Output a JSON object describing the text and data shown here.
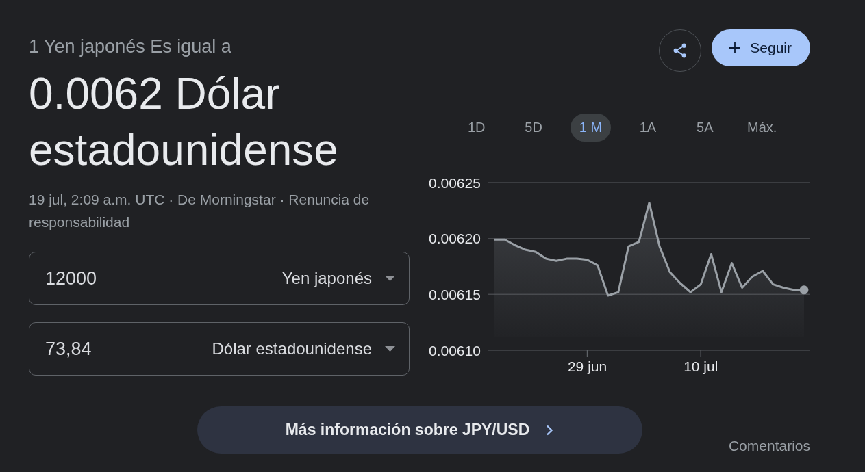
{
  "conversion": {
    "subtitle": "1 Yen japonés Es igual a",
    "result": "0.0062 Dólar estadounidense",
    "source_note": "19 jul, 2:09 a.m. UTC · De Morningstar · Renuncia de responsabilidad"
  },
  "converter": [
    {
      "amount": "12000",
      "currency": "Yen japonés"
    },
    {
      "amount": "73,84",
      "currency": "Dólar estadounidense"
    }
  ],
  "follow_button": {
    "label": "Seguir"
  },
  "range_tabs": [
    {
      "label": "1D",
      "selected": false
    },
    {
      "label": "5D",
      "selected": false
    },
    {
      "label": "1 M",
      "selected": true
    },
    {
      "label": "1A",
      "selected": false
    },
    {
      "label": "5A",
      "selected": false
    },
    {
      "label": "Máx.",
      "selected": false
    }
  ],
  "chart_data": {
    "type": "area",
    "categories": [
      null,
      null,
      null,
      null,
      null,
      null,
      null,
      null,
      null,
      "29 jun",
      null,
      null,
      null,
      null,
      null,
      null,
      null,
      null,
      null,
      null,
      "10 jul",
      null,
      null,
      null,
      null,
      null,
      null,
      null,
      null,
      null,
      null
    ],
    "values": [
      0.006199,
      0.006199,
      0.006194,
      0.00619,
      0.006188,
      0.006182,
      0.00618,
      0.006182,
      0.006182,
      0.006181,
      0.006176,
      0.006149,
      0.006152,
      0.006193,
      0.006197,
      0.006232,
      0.006193,
      0.00617,
      0.00616,
      0.006152,
      0.006159,
      0.006186,
      0.006152,
      0.006178,
      0.006156,
      0.006166,
      0.006171,
      0.006159,
      0.006156,
      0.006154,
      0.006154
    ],
    "ylim": [
      0.0061,
      0.00625
    ],
    "yticks": [
      {
        "value": 0.0061,
        "label": "0.00610"
      },
      {
        "value": 0.00615,
        "label": "0.00615"
      },
      {
        "value": 0.0062,
        "label": "0.00620"
      },
      {
        "value": 0.00625,
        "label": "0.00625"
      }
    ]
  },
  "more_info_button": {
    "label": "Más información sobre JPY/USD"
  },
  "feedback_link": {
    "label": "Comentarios"
  }
}
